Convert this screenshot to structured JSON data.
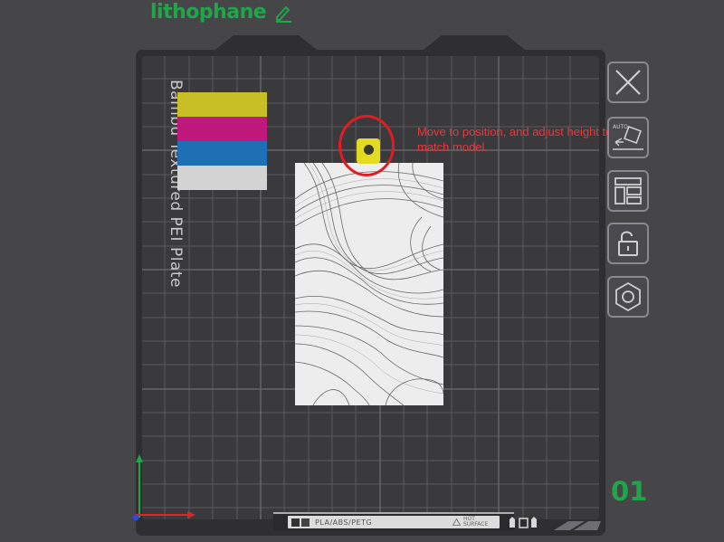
{
  "plate": {
    "title": "lithophane",
    "number": "01",
    "bed_label": "Bambu Textured PEI Plate",
    "bed_info_materials": "PLA/ABS/PETG",
    "bed_info_hot": "HOT SURFACE"
  },
  "annotation": {
    "note": "Move to position, and adjust height to match model."
  },
  "swatches": [
    "#c8bf26",
    "#c0197d",
    "#1e6fb3",
    "#d3d3d3"
  ],
  "toolbar": [
    {
      "name": "close-plate-button",
      "icon": "close-icon"
    },
    {
      "name": "auto-orient-button",
      "icon": "auto-orient-icon"
    },
    {
      "name": "arrange-button",
      "icon": "arrange-icon"
    },
    {
      "name": "lock-button",
      "icon": "unlock-icon"
    },
    {
      "name": "plate-settings-button",
      "icon": "hex-nut-icon"
    }
  ],
  "colors": {
    "accent": "#1fa64a",
    "annotation": "#e11d24",
    "background": "#464649",
    "bed": "#38383b"
  }
}
